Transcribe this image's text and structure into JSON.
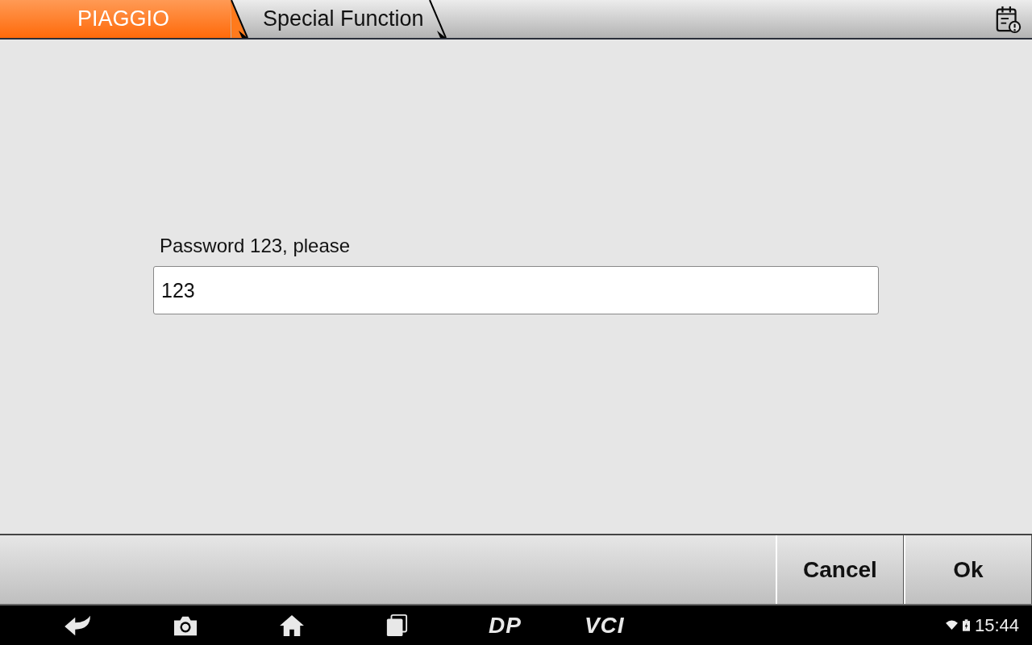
{
  "breadcrumbs": [
    {
      "label": "PIAGGIO",
      "selected": true
    },
    {
      "label": "Special Function",
      "selected": false
    }
  ],
  "prompt": {
    "label": "Password 123, please",
    "value": "123"
  },
  "buttons": [
    "Cancel",
    "Ok"
  ],
  "nav_bar": {
    "logos": [
      "DP",
      "VCI"
    ],
    "time": "15:44"
  }
}
